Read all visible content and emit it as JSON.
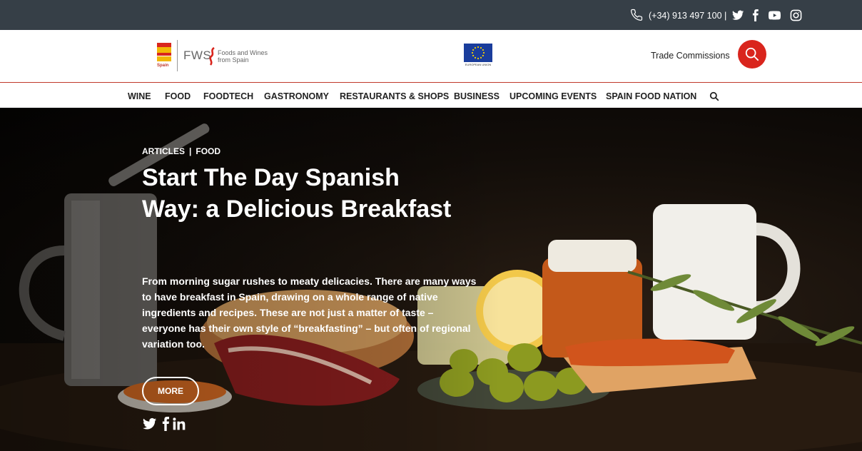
{
  "topbar": {
    "phone": "(+34) 913 497 100",
    "separator": "|",
    "social_icons": [
      "twitter-icon",
      "facebook-icon",
      "youtube-icon",
      "instagram-icon"
    ],
    "background": "#363f47"
  },
  "header": {
    "logo": {
      "flag_label": "Spain",
      "brand": "FWS",
      "tagline_line1": "Foods and Wines",
      "tagline_line2": "from Spain"
    },
    "eu_label": "EUROPEAN UNION",
    "trade_link": "Trade Commissions",
    "search_color": "#d9251d"
  },
  "nav": {
    "items": [
      {
        "label": "WINE"
      },
      {
        "label": "FOOD"
      },
      {
        "label": "FOODTECH"
      },
      {
        "label": "GASTRONOMY"
      },
      {
        "label": "RESTAURANTS & SHOPS"
      },
      {
        "label": "BUSINESS"
      },
      {
        "label": "UPCOMING EVENTS"
      },
      {
        "label": "SPAIN FOOD NATION"
      }
    ]
  },
  "hero": {
    "category1": "ARTICLES",
    "category_sep": "|",
    "category2": "FOOD",
    "title": "Start The Day Spanish Way: a Delicious Breakfast",
    "description": "From morning sugar rushes to meaty delicacies. There are many ways to have breakfast in Spain, drawing on a whole range of native ingredients and recipes. These are not just a matter of taste – everyone has their own style of “breakfasting” – but often of regional variation too.",
    "more_label": "MORE",
    "share_icons": [
      "twitter-icon",
      "facebook-icon",
      "linkedin-icon"
    ]
  }
}
